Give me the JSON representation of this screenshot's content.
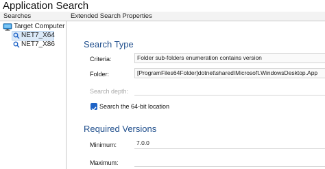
{
  "window": {
    "title": "Application Search"
  },
  "left": {
    "header": "Searches",
    "tree": {
      "root": "Target Computer",
      "children": [
        {
          "label": "NET7_X64",
          "selected": true
        },
        {
          "label": "NET7_X86",
          "selected": false
        }
      ]
    }
  },
  "right": {
    "header": "Extended Search Properties",
    "search_type": {
      "heading": "Search Type",
      "criteria_label": "Criteria:",
      "criteria_value": "Folder sub-folders enumeration contains version",
      "folder_label": "Folder:",
      "folder_value": "[ProgramFiles64Folder]dotnet\\shared\\Microsoft.WindowsDesktop.App",
      "depth_label": "Search depth:",
      "depth_value": "",
      "checkbox_label": "Search the 64-bit location",
      "checkbox_checked": true
    },
    "required_versions": {
      "heading": "Required Versions",
      "minimum_label": "Minimum:",
      "minimum_value": "7.0.0",
      "maximum_label": "Maximum:",
      "maximum_value": ""
    }
  },
  "colors": {
    "accent": "#1f4e8c",
    "checkbox": "#1f63c6",
    "selection": "#dbe9f8"
  }
}
